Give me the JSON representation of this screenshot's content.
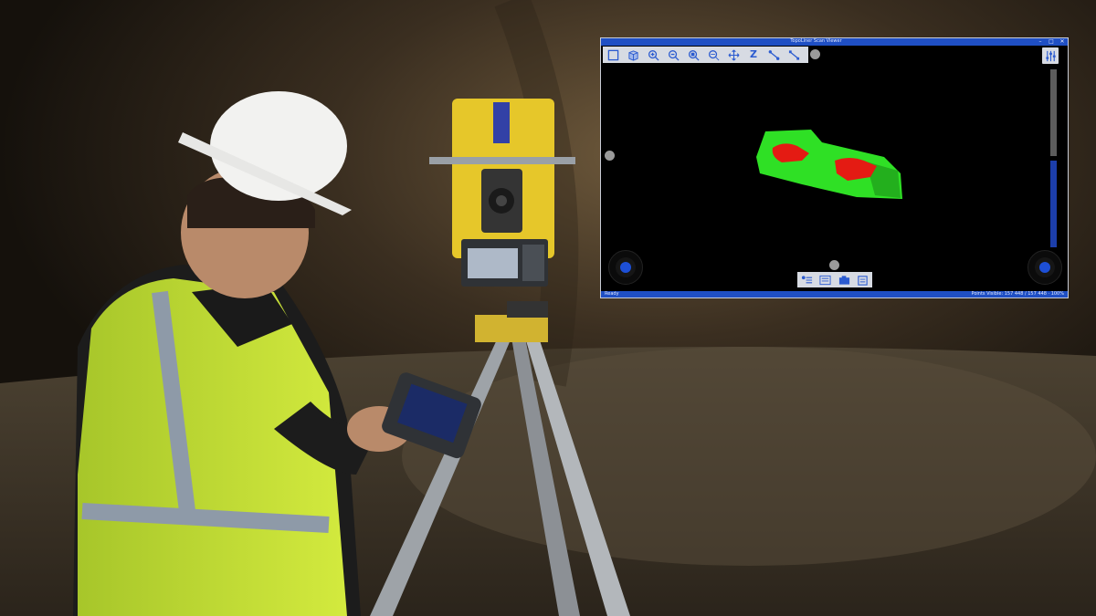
{
  "window": {
    "title": "TopoLiner Scan Viewer",
    "controls": [
      "–",
      "□",
      "✕"
    ]
  },
  "toolbar": {
    "buttons": [
      {
        "name": "view-box-icon"
      },
      {
        "name": "view-3d-icon"
      },
      {
        "name": "zoom-in-icon"
      },
      {
        "name": "zoom-out-icon"
      },
      {
        "name": "zoom-window-icon"
      },
      {
        "name": "zoom-fit-icon"
      },
      {
        "name": "pan-icon"
      },
      {
        "name": "z-axis-label",
        "label": "Z"
      },
      {
        "name": "measure-icon"
      },
      {
        "name": "measure-alt-icon"
      }
    ]
  },
  "status": {
    "left": "Ready",
    "right": "Points Visible: 157 448 / 157 448 · 100%"
  },
  "colors": {
    "title_bar": "#1f4fc4",
    "toolbar": "#d7dbe3",
    "point_cloud_green": "#2fe025",
    "point_cloud_red": "#e41b13",
    "accent_blue": "#1d4fd6"
  }
}
